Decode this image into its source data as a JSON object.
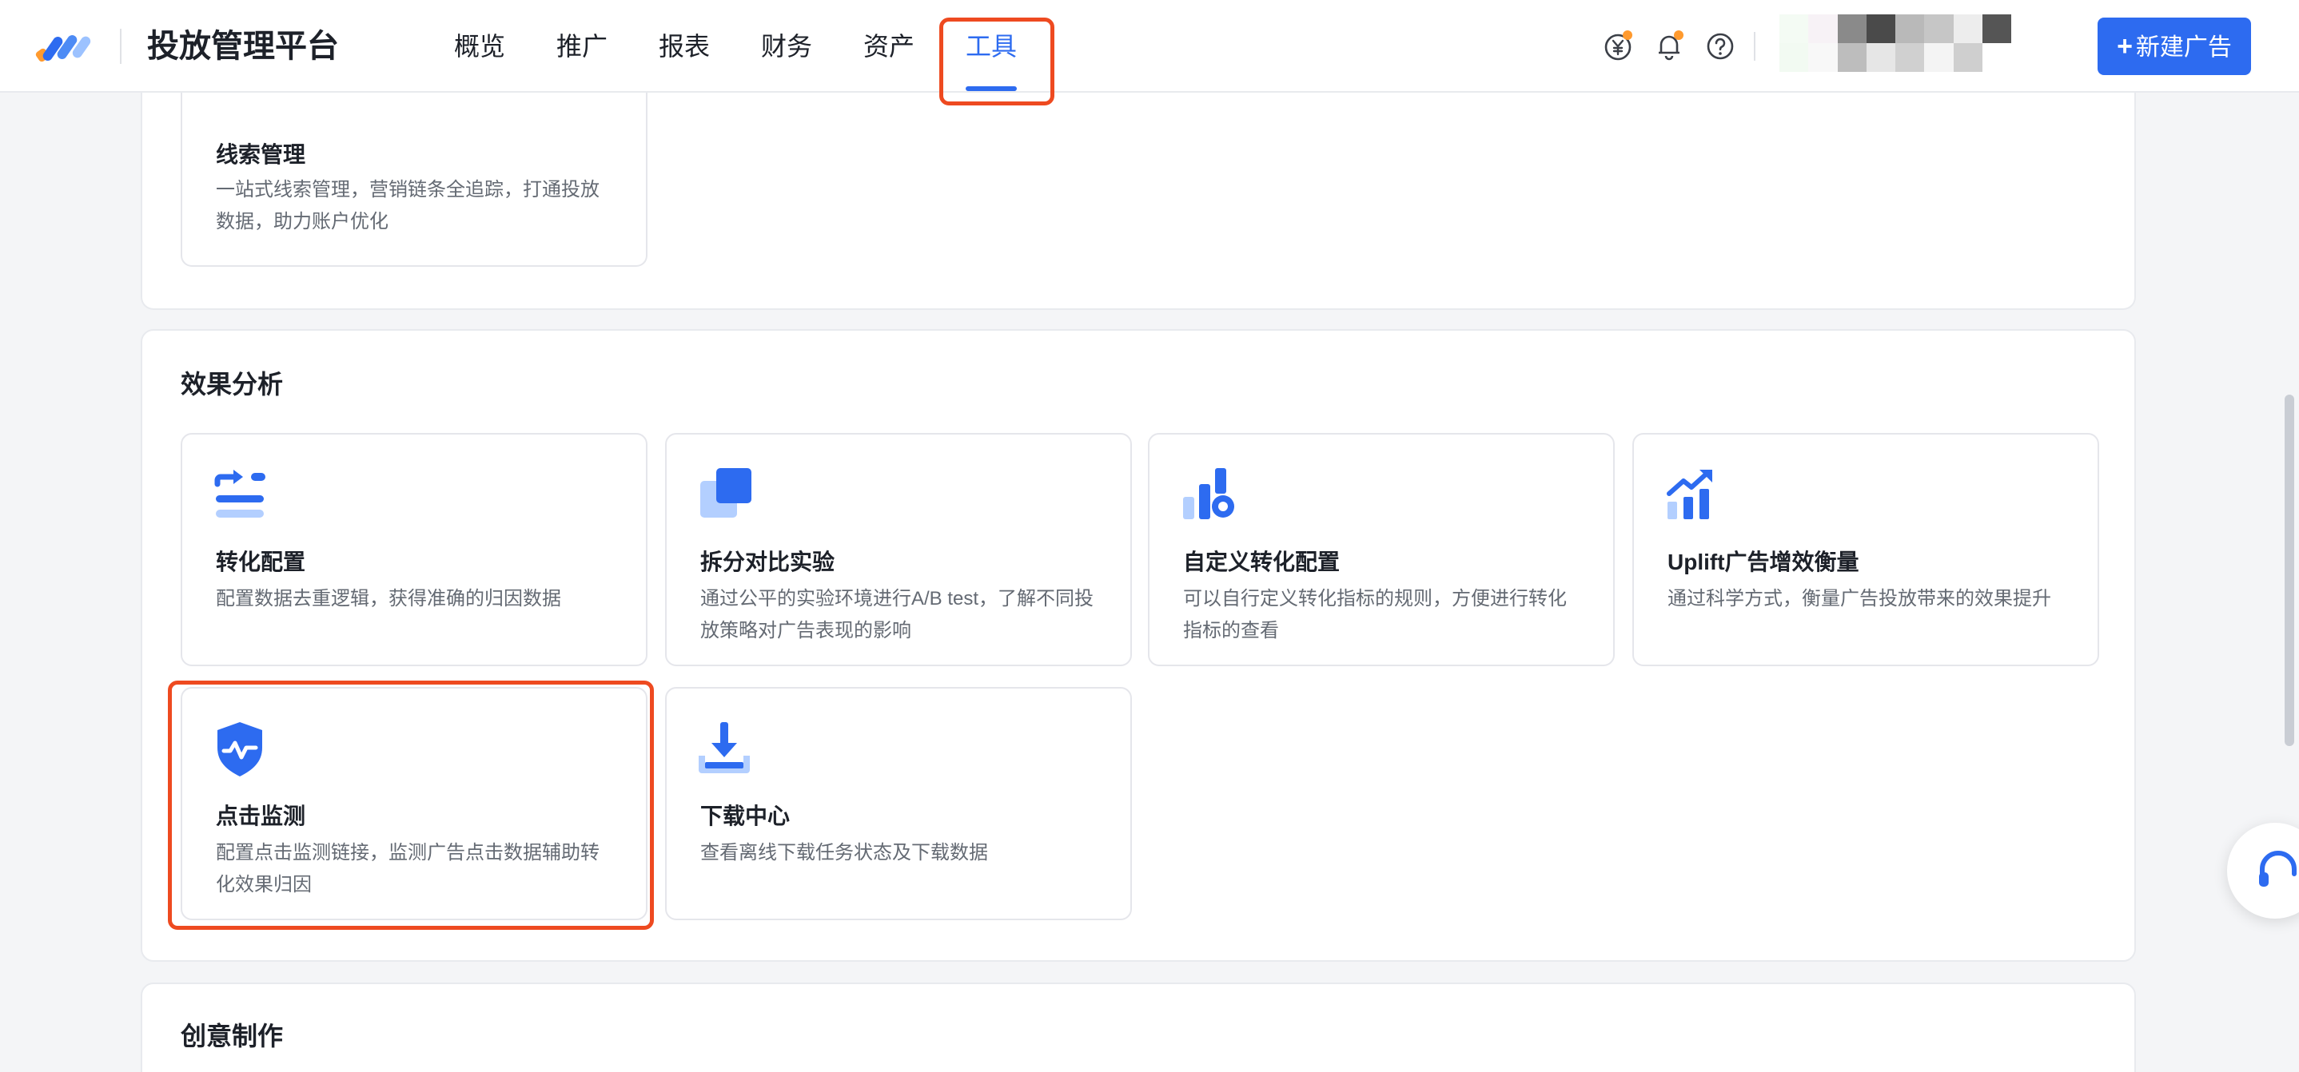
{
  "header": {
    "app_title": "投放管理平台",
    "tabs": [
      {
        "label": "概览",
        "active": false
      },
      {
        "label": "推广",
        "active": false
      },
      {
        "label": "报表",
        "active": false
      },
      {
        "label": "财务",
        "active": false
      },
      {
        "label": "资产",
        "active": false
      },
      {
        "label": "工具",
        "active": true
      }
    ],
    "icons": [
      "yuan-coin-icon",
      "bell-icon",
      "help-circle-icon"
    ],
    "create_button_label": "新建广告",
    "accent_color": "#2d6bf0",
    "highlight_color": "#ee4a20"
  },
  "lead_section": {
    "card": {
      "title": "线索管理",
      "desc": "一站式线索管理，营销链条全追踪，打通投放数据，助力账户优化",
      "icon": "lead-funnel-icon"
    }
  },
  "effect_section": {
    "title": "效果分析",
    "cards": [
      {
        "title": "转化配置",
        "desc": "配置数据去重逻辑，获得准确的归因数据",
        "icon": "conversion-config-icon"
      },
      {
        "title": "拆分对比实验",
        "desc": "通过公平的实验环境进行A/B test，了解不同投放策略对广告表现的影响",
        "icon": "ab-test-icon"
      },
      {
        "title": "自定义转化配置",
        "desc": "可以自行定义转化指标的规则，方便进行转化指标的查看",
        "icon": "custom-conversion-icon"
      },
      {
        "title": "Uplift广告增效衡量",
        "desc": "通过科学方式，衡量广告投放带来的效果提升",
        "icon": "uplift-chart-icon"
      },
      {
        "title": "点击监测",
        "desc": "配置点击监测链接，监测广告点击数据辅助转化效果归因",
        "icon": "shield-pulse-icon"
      },
      {
        "title": "下载中心",
        "desc": "查看离线下载任务状态及下载数据",
        "icon": "download-icon"
      }
    ]
  },
  "creative_section": {
    "title": "创意制作"
  }
}
